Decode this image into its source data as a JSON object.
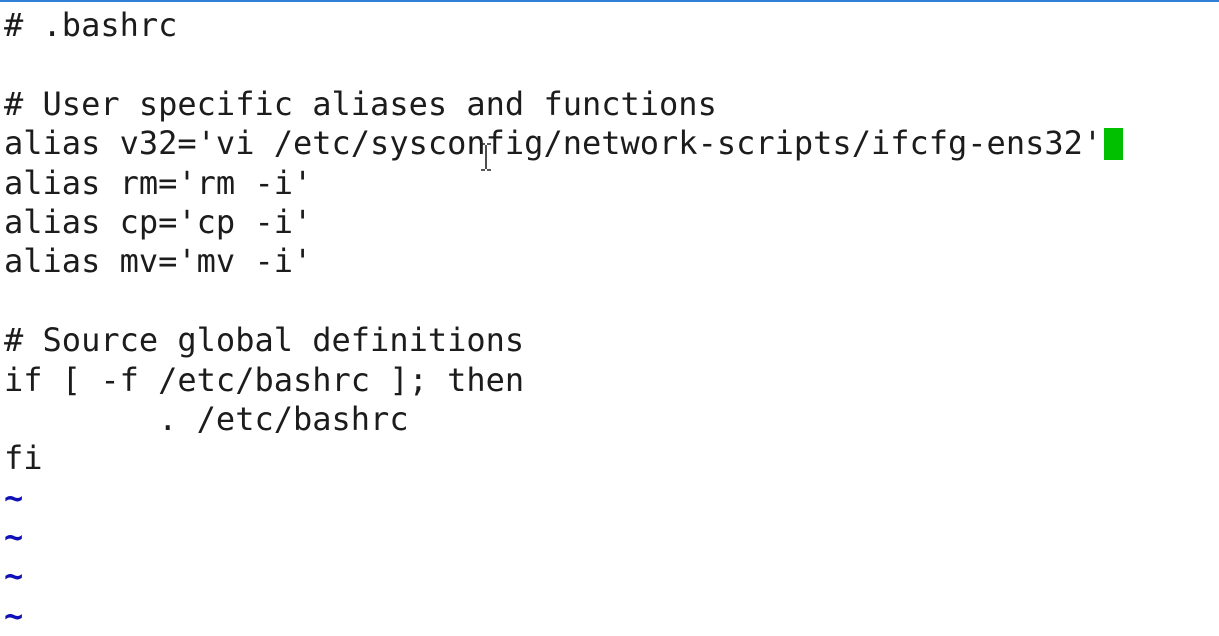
{
  "editor": {
    "lines": [
      "# .bashrc",
      "",
      "# User specific aliases and functions",
      "alias v32='vi /etc/sysconfig/network-scripts/ifcfg-ens32'",
      "alias rm='rm -i'",
      "alias cp='cp -i'",
      "alias mv='mv -i'",
      "",
      "# Source global definitions",
      "if [ -f /etc/bashrc ]; then",
      "        . /etc/bashrc",
      "fi"
    ],
    "empty_line_marker": "~",
    "colors": {
      "text": "#1c1c1c",
      "tilde": "#1010b8",
      "cursor": "#00c000",
      "top_border": "#2f7fd6"
    },
    "icons": {
      "block_cursor": "text-cursor-icon",
      "mouse_pointer": "ibeam-pointer-icon"
    }
  }
}
